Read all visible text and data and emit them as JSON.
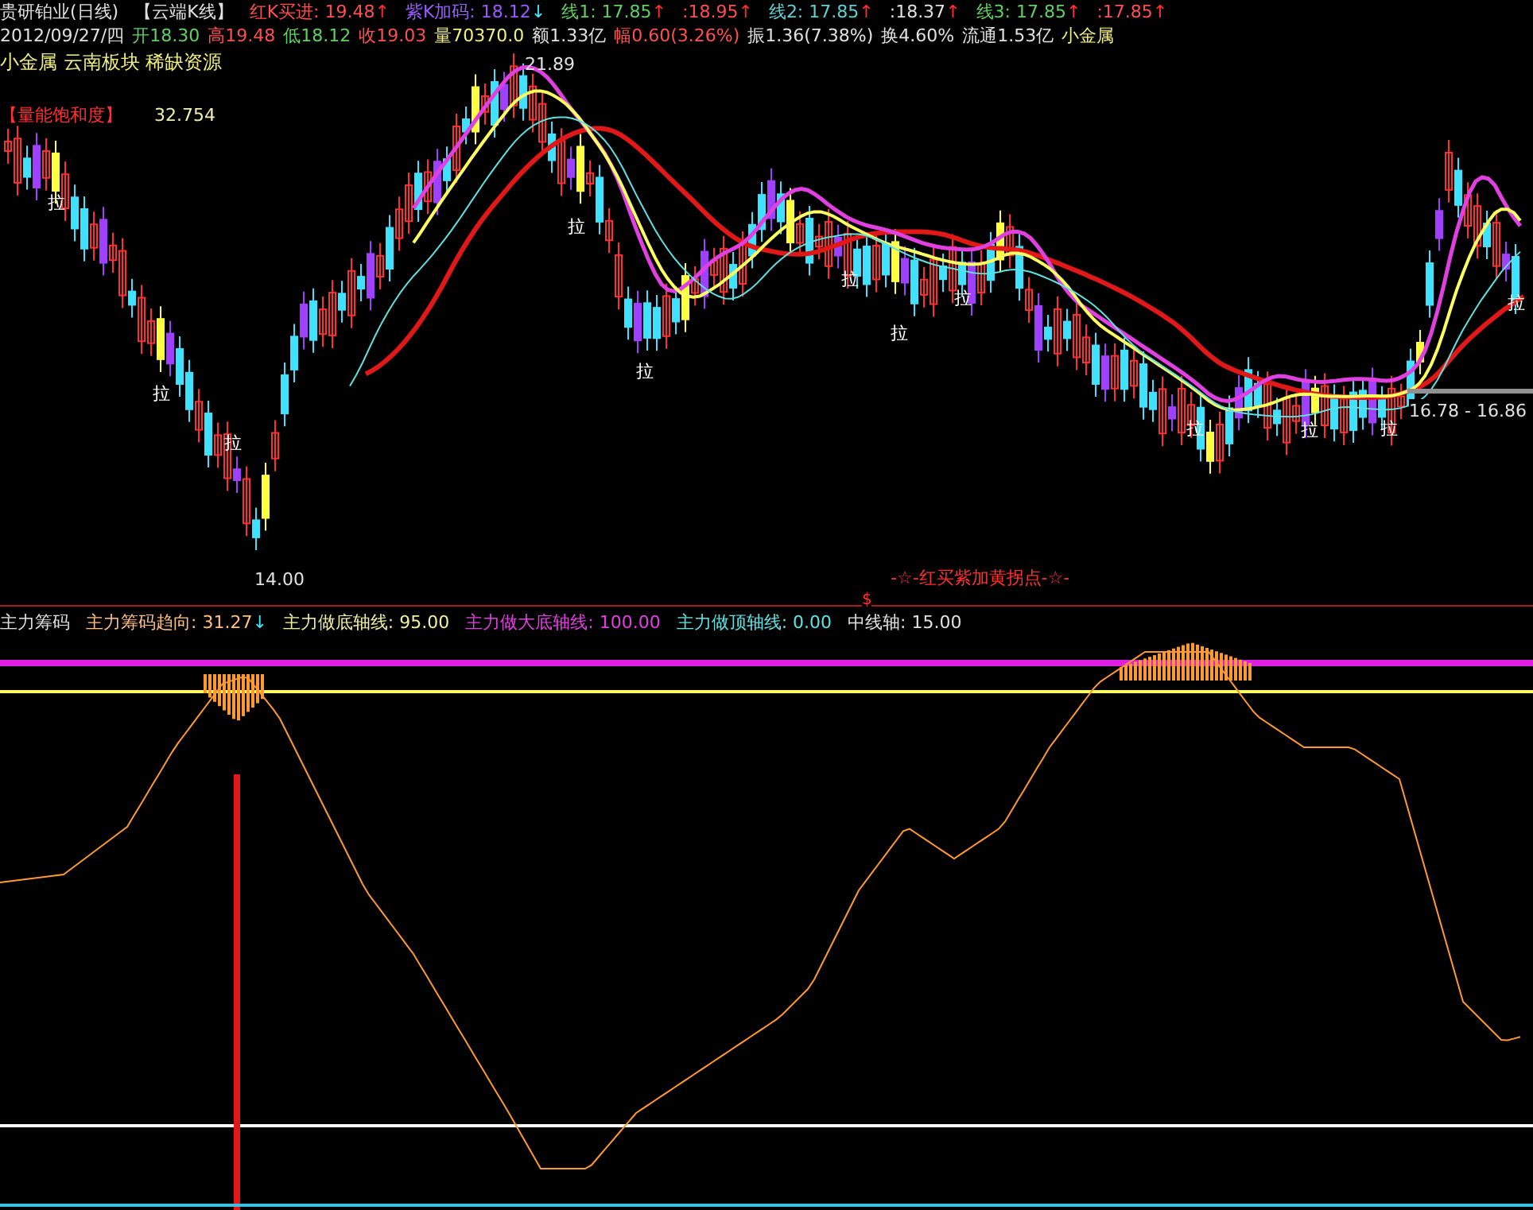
{
  "header_row": [
    {
      "text": "贵研铂业(日线)",
      "color": "#e0e0e0"
    },
    {
      "text": "【云端K线】",
      "color": "#e0e0e0"
    },
    {
      "text": "红K买进: 19.48",
      "color": "#ff5050",
      "arrow": {
        "text": "↑",
        "color": "#ff3030"
      }
    },
    {
      "text": "紫K加码: 18.12",
      "color": "#9a5cff",
      "arrow": {
        "text": "↓",
        "color": "#40e8ff"
      }
    },
    {
      "text": "线1: 17.85",
      "color": "#60d060",
      "arrow": {
        "text": "↑",
        "color": "#ff3030"
      }
    },
    {
      "text": ":18.95",
      "color": "#ff5050",
      "arrow": {
        "text": "↑",
        "color": "#ff3030"
      }
    },
    {
      "text": "线2: 17.85",
      "color": "#60d0d0",
      "arrow": {
        "text": "↑",
        "color": "#ff3030"
      }
    },
    {
      "text": ":18.37",
      "color": "#e0e0e0",
      "arrow": {
        "text": "↑",
        "color": "#ff3030"
      }
    },
    {
      "text": "线3: 17.85",
      "color": "#60d060",
      "arrow": {
        "text": "↑",
        "color": "#ff3030"
      }
    },
    {
      "text": ":17.85",
      "color": "#ff5050",
      "arrow": {
        "text": "↑",
        "color": "#ff3030"
      }
    }
  ],
  "quote_row": [
    {
      "text": "2012/09/27/四",
      "color": "#e0e0e0"
    },
    {
      "text": "开18.30",
      "color": "#60d060"
    },
    {
      "text": "高19.48",
      "color": "#ff5050"
    },
    {
      "text": "低18.12",
      "color": "#60d060"
    },
    {
      "text": "收19.03",
      "color": "#ff5050"
    },
    {
      "text": "量70370.0",
      "color": "#f0f080"
    },
    {
      "text": "额1.33亿",
      "color": "#e0e0e0"
    },
    {
      "text": "幅0.60(3.26%)",
      "color": "#ff5050"
    },
    {
      "text": "振1.36(7.38%)",
      "color": "#e0e0e0"
    },
    {
      "text": "换4.60%",
      "color": "#e0e0e0"
    },
    {
      "text": "流通1.53亿",
      "color": "#e0e0e0"
    },
    {
      "text": "小金属",
      "color": "#f0f080"
    }
  ],
  "sector_tags": "小金属 云南板块 稀缺资源",
  "volume_saturation": {
    "label": "【量能饱和度】",
    "value": "32.754"
  },
  "price_labels": {
    "high": "21.89",
    "low": "14.00",
    "range": "16.78 - 16.86"
  },
  "pull_marks": [
    "拉",
    "拉",
    "拉",
    "拉",
    "拉",
    "拉",
    "拉",
    "拉",
    "拉",
    "拉",
    "拉",
    "拉"
  ],
  "legend_caption": "-☆-红买紫加黄拐点-☆-",
  "dollar_mark": "$",
  "indicator_header": [
    {
      "text": "主力筹码",
      "color": "#e0e0e0"
    },
    {
      "text": "主力筹码趋向: 31.27",
      "color": "#ffc080",
      "arrow": {
        "text": "↓",
        "color": "#40e8ff"
      }
    },
    {
      "text": "主力做底轴线: 95.00",
      "color": "#f0f0a0"
    },
    {
      "text": "主力做大底轴线: 100.00",
      "color": "#e040e0"
    },
    {
      "text": "主力做顶轴线: 0.00",
      "color": "#60e0e0"
    },
    {
      "text": "中线轴: 15.00",
      "color": "#e0e0e0"
    }
  ]
}
